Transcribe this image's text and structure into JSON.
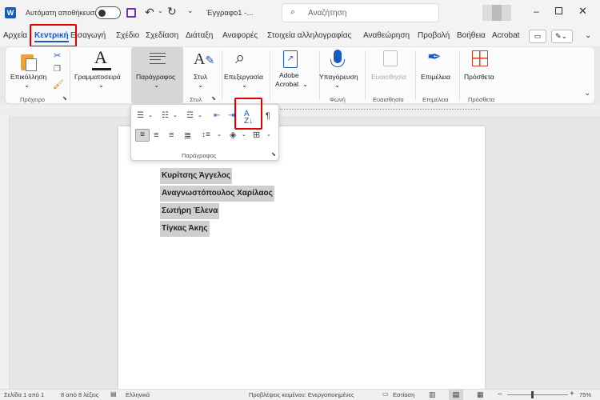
{
  "titlebar": {
    "autosave_label": "Αυτόματη αποθήκευση",
    "doc_title": "Έγγραφο1  -...",
    "search_placeholder": "Αναζήτηση",
    "word_icon": "word-logo-icon"
  },
  "tabs": [
    "Αρχεία",
    "Κεντρική",
    "Εισαγωγή",
    "Σχέδιο",
    "Σχεδίαση",
    "Διάταξη",
    "Αναφορές",
    "Στοιχεία αλληλογραφίας",
    "Αναθεώρηση",
    "Προβολή",
    "Βοήθεια",
    "Acrobat"
  ],
  "ribbon": {
    "paste": "Επικόλληση",
    "clipboard_group": "Πρόχειρο",
    "font": "Γραμματοσειρά",
    "paragraph": "Παράγραφος",
    "styles": "Στυλ",
    "styles_group": "Στυλ",
    "editing": "Επεξεργασία",
    "adobe1": "Adobe",
    "adobe2": "Acrobat",
    "dictate": "Υπαγόρευση",
    "voice_group": "Φωνή",
    "sensitivity": "Ευαισθησία",
    "sensitivity_group": "Ευαισθησία",
    "editor": "Επιμέλεια",
    "editor_group": "Επιμέλεια",
    "addins": "Πρόσθετα",
    "addins_group": "Πρόσθετα"
  },
  "popup": {
    "label": "Παράγραφος"
  },
  "document": {
    "lines": [
      "Κυρίτσης Άγγελος",
      "Αναγνωστόπουλος Χαρίλαος",
      "Σωτήρη Έλενα",
      "Τίγκας Άκης"
    ]
  },
  "status": {
    "page": "Σελίδα 1 από 1",
    "words": "8 από 8 λέξεις",
    "language": "Ελληνικά",
    "predictions": "Προβλέψεις κειμένου: Ενεργοποιημένες",
    "focus": "Εστίαση",
    "zoom": "75%"
  },
  "colors": {
    "accent": "#185abd",
    "highlight_box": "#e00000",
    "selection": "#cfcfcf"
  }
}
